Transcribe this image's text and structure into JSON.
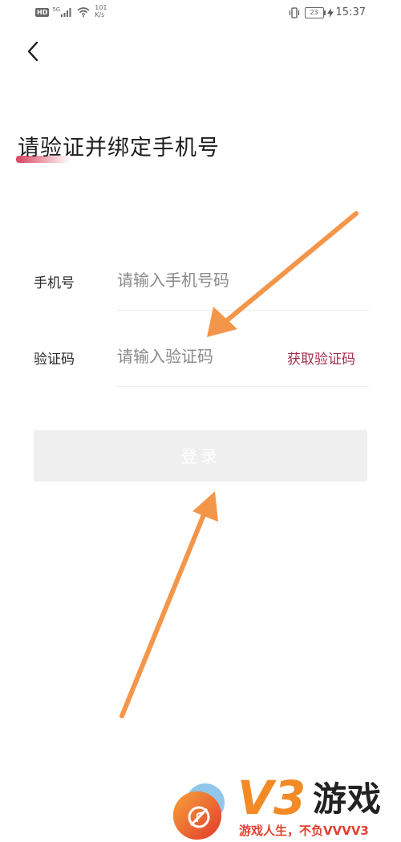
{
  "status_bar": {
    "hd": "HD",
    "network_type": "5G",
    "speed_value": "101",
    "speed_unit": "K/s",
    "battery": "23",
    "time": "15:37",
    "icons": [
      "hd-badge",
      "signal-icon",
      "wifi-icon",
      "vibrate-icon",
      "battery-icon",
      "charge-icon"
    ]
  },
  "header": {
    "back_icon": "chevron-left-icon"
  },
  "title": "请验证并绑定手机号",
  "form": {
    "phone": {
      "label": "手机号",
      "placeholder": "请输入手机号码",
      "value": ""
    },
    "code": {
      "label": "验证码",
      "placeholder": "请输入验证码",
      "value": "",
      "get_code_label": "获取验证码"
    },
    "login_label": "登录"
  },
  "watermark": {
    "logo_text": "V3",
    "brand": "游戏",
    "slogan": "游戏人生，不负VVVV3"
  },
  "colors": {
    "accent": "#a3304e",
    "title_underline": "#d8425d",
    "login_bg": "#efefef",
    "arrow": "#f3964a",
    "watermark_orange": "#f38a25",
    "watermark_red": "#e2402f"
  }
}
